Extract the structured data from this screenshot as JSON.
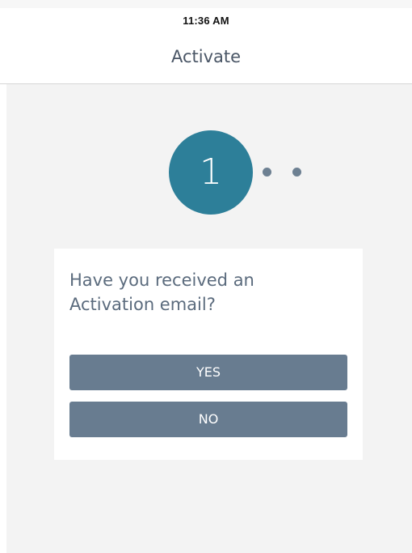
{
  "status_bar": {
    "time": "11:36 AM"
  },
  "nav": {
    "title": "Activate"
  },
  "steps": {
    "current": "1",
    "total": 3,
    "current_index": 1
  },
  "card": {
    "question": "Have you received an Activation email?",
    "yes_label": "YES",
    "no_label": "NO"
  },
  "colors": {
    "accent": "#2d7f99",
    "button": "#687c90",
    "text": "#5b6b7d",
    "background": "#f3f3f3"
  }
}
